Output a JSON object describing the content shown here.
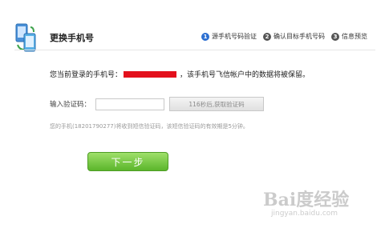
{
  "header": {
    "title": "更换手机号",
    "steps": [
      {
        "num": "1",
        "label": "源手机号码验证"
      },
      {
        "num": "2",
        "label": "确认目标手机号码"
      },
      {
        "num": "3",
        "label": "信息预览"
      }
    ]
  },
  "account": {
    "prefix": "您当前登录的手机号：",
    "suffix": "，该手机号飞信帐户中的数据将被保留。"
  },
  "verify": {
    "label": "输入验证码：",
    "input_value": "",
    "resend_label": "116秒后,获取验证码"
  },
  "hint": "您的手机(18201790277)将收到短信验证码，该短信验证码的有效期是5分钟。",
  "next_label": "下一步",
  "watermark": {
    "logo_text": "Bai度经验",
    "url": "jingyan.baidu.com"
  },
  "colors": {
    "active_step": "#2c6fd1",
    "mask": "#e3101c",
    "button_green": "#5bb52b"
  }
}
